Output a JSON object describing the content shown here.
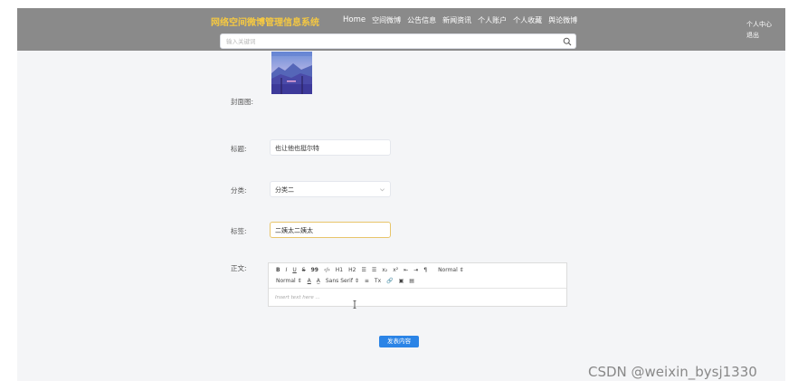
{
  "header": {
    "brand": "网络空间微博管理信息系统",
    "nav": [
      "Home",
      "空间微博",
      "公告信息",
      "新闻资讯",
      "个人账户",
      "个人收藏",
      "舆论微博"
    ],
    "user_links": [
      "个人中心",
      "退出"
    ],
    "search_placeholder": "输入关键词"
  },
  "form": {
    "cover_label": "封面图:",
    "title_label": "标题:",
    "title_value": "也让他也挺尔特",
    "category_label": "分类:",
    "category_value": "分类二",
    "tags_label": "标签:",
    "tags_value": "二姨太二姨太",
    "body_label": "正文:",
    "editor": {
      "toolbar_row1": [
        "B",
        "I",
        "U",
        "S",
        "99",
        "‹/›",
        "H1",
        "H2",
        "☰",
        "☰",
        "x₂",
        "x²",
        "⇤",
        "⇥",
        "¶",
        "Normal ⇕"
      ],
      "toolbar_row2": [
        "Normal ⇕",
        "A",
        "A̲",
        "Sans Serif ⇕",
        "≡",
        "Tx",
        "🔗",
        "▣",
        "▤"
      ],
      "placeholder": "Insert text here ..."
    },
    "submit_label": "发表内容"
  },
  "watermark": "CSDN @weixin_bysj1330",
  "colors": {
    "topbar": "#8a8a8a",
    "brand": "#f5c842",
    "primary": "#2b84e6",
    "focus_border": "#e8c56a"
  },
  "icons": {
    "search": "search-icon",
    "chevron": "chevron-down-icon"
  }
}
